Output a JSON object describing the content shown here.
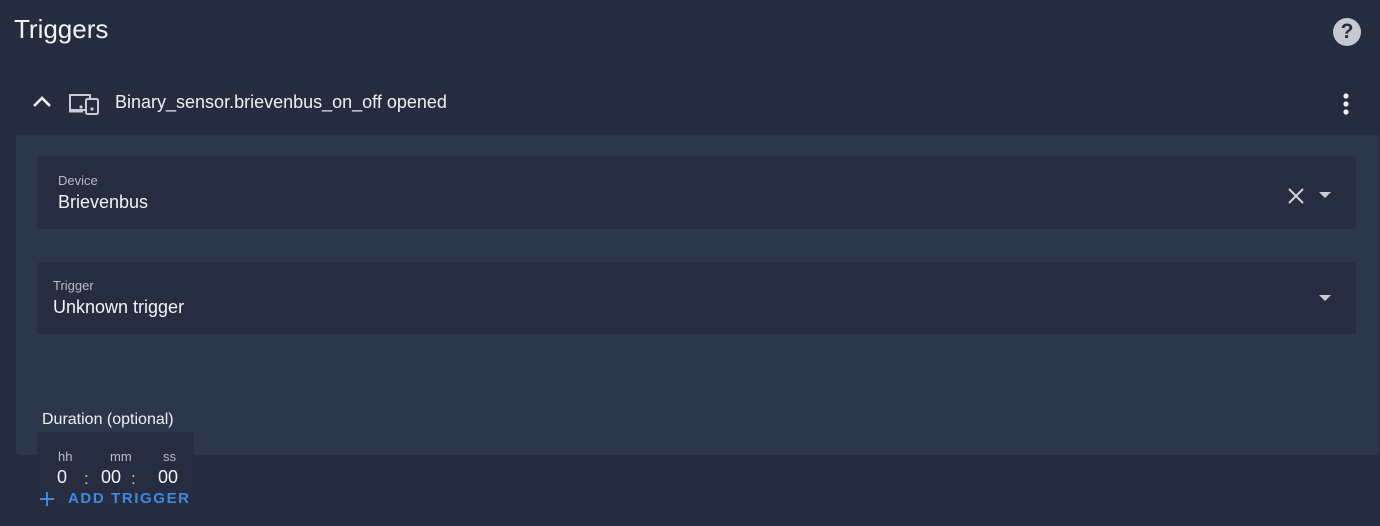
{
  "section": {
    "title": "Triggers",
    "help_icon": "help-circle-icon",
    "help_label": "?"
  },
  "trigger_card": {
    "header_title": "Binary_sensor.brievenbus_on_off opened",
    "collapse_icon": "chevron-up-icon",
    "type_icon": "devices-icon",
    "menu_icon": "dots-vertical-icon",
    "device": {
      "label": "Device",
      "value": "Brievenbus",
      "clear_icon": "close-icon",
      "arrow_icon": "menu-down-icon"
    },
    "trigger": {
      "label": "Trigger",
      "value": "Unknown trigger",
      "arrow_icon": "menu-down-icon"
    },
    "duration": {
      "label": "Duration (optional)",
      "hours": {
        "unit": "hh",
        "value": "0"
      },
      "minutes": {
        "unit": "mm",
        "value": "00"
      },
      "seconds": {
        "unit": "ss",
        "value": "00"
      },
      "separator": ":"
    }
  },
  "add_trigger": {
    "label": "ADD TRIGGER",
    "icon": "plus-icon"
  },
  "colors": {
    "background": "#262c3f",
    "card_body": "#2d374b",
    "field_bg": "#262d40",
    "accent": "#3d8ae0",
    "text": "#eef0f5"
  }
}
